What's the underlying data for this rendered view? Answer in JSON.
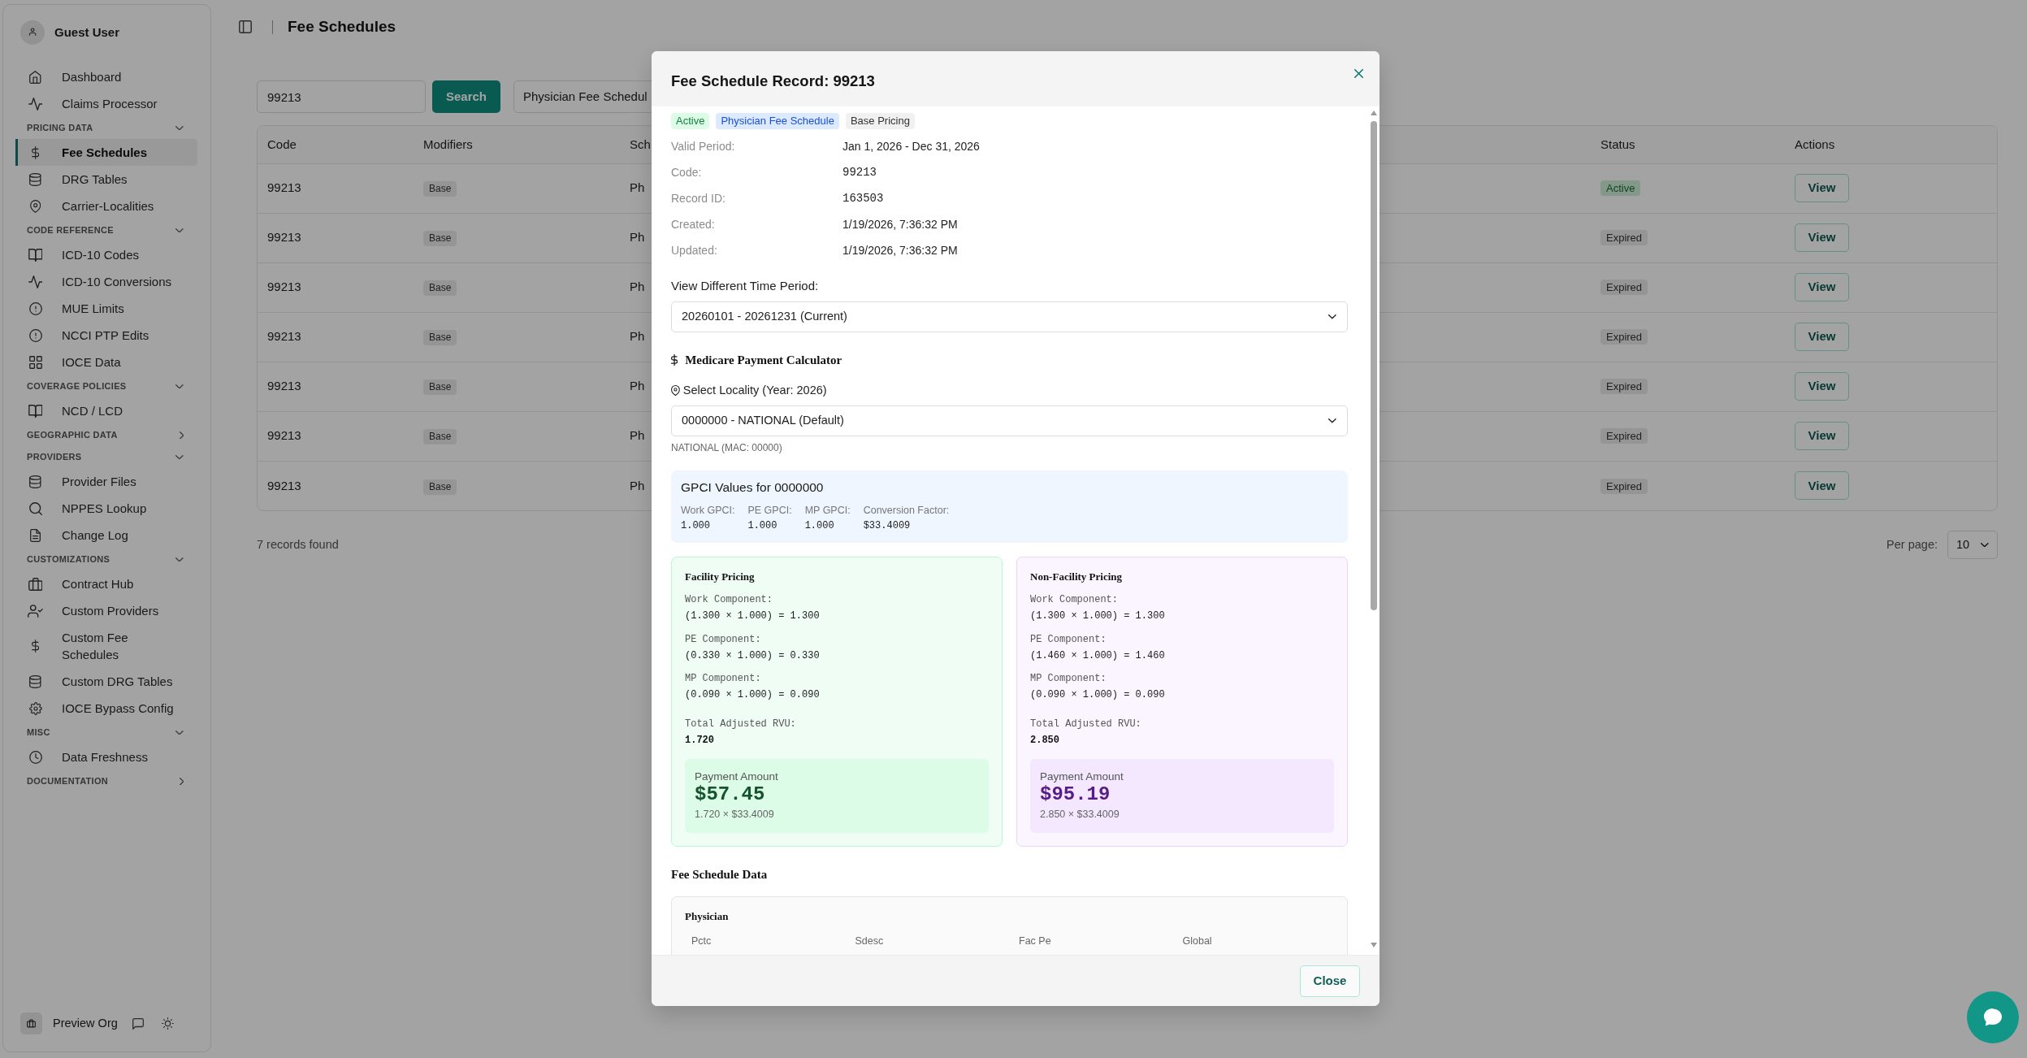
{
  "sidebar": {
    "user": "Guest User",
    "nav": [
      {
        "kind": "link",
        "label": "Dashboard",
        "selected": false
      },
      {
        "kind": "link",
        "label": "Claims Processor",
        "selected": false
      },
      {
        "kind": "section",
        "label": "PRICING DATA",
        "expanded": true,
        "children": [
          {
            "label": "Fee Schedules",
            "selected": true
          },
          {
            "label": "DRG Tables",
            "selected": false
          },
          {
            "label": "Carrier-Localities",
            "selected": false
          }
        ]
      },
      {
        "kind": "section",
        "label": "CODE REFERENCE",
        "expanded": true,
        "children": [
          {
            "label": "ICD-10 Codes",
            "selected": false
          },
          {
            "label": "ICD-10 Conversions",
            "selected": false
          },
          {
            "label": "MUE Limits",
            "selected": false
          },
          {
            "label": "NCCI PTP Edits",
            "selected": false
          },
          {
            "label": "IOCE Data",
            "selected": false
          }
        ]
      },
      {
        "kind": "section",
        "label": "COVERAGE POLICIES",
        "expanded": true,
        "children": [
          {
            "label": "NCD / LCD",
            "selected": false
          }
        ]
      },
      {
        "kind": "section",
        "label": "GEOGRAPHIC DATA",
        "expanded": false
      },
      {
        "kind": "section",
        "label": "PROVIDERS",
        "expanded": true,
        "children": [
          {
            "label": "Provider Files",
            "selected": false
          },
          {
            "label": "NPPES Lookup",
            "selected": false
          },
          {
            "label": "Change Log",
            "selected": false
          }
        ]
      },
      {
        "kind": "section",
        "label": "CUSTOMIZATIONS",
        "expanded": true,
        "children": [
          {
            "label": "Contract Hub",
            "selected": false
          },
          {
            "label": "Custom Providers",
            "selected": false
          },
          {
            "label": "Custom Fee Schedules",
            "selected": false
          },
          {
            "label": "Custom DRG Tables",
            "selected": false
          },
          {
            "label": "IOCE Bypass Config",
            "selected": false
          }
        ]
      },
      {
        "kind": "section",
        "label": "MISC",
        "expanded": true,
        "children": [
          {
            "label": "Data Freshness",
            "selected": false
          }
        ]
      },
      {
        "kind": "section",
        "label": "DOCUMENTATION",
        "expanded": false
      }
    ],
    "org": "Preview Org"
  },
  "header": {
    "title": "Fee Schedules"
  },
  "search": {
    "value": "99213",
    "button": "Search",
    "schedule": "Physician Fee Schedul"
  },
  "table": {
    "columns": [
      "Code",
      "Modifiers",
      "Sch",
      "Status",
      "Actions"
    ],
    "rows": [
      {
        "kind": "active",
        "code": "99213",
        "modifier": "Base",
        "column_3": "Ph",
        "status": "Active",
        "action": "View"
      },
      {
        "kind": "expired",
        "code": "99213",
        "modifier": "Base",
        "column_3": "Ph",
        "status": "Expired",
        "action": "View"
      },
      {
        "kind": "expired",
        "code": "99213",
        "modifier": "Base",
        "column_3": "Ph",
        "status": "Expired",
        "action": "View"
      },
      {
        "kind": "expired",
        "code": "99213",
        "modifier": "Base",
        "column_3": "Ph",
        "status": "Expired",
        "action": "View"
      },
      {
        "kind": "expired",
        "code": "99213",
        "modifier": "Base",
        "column_3": "Ph",
        "status": "Expired",
        "action": "View"
      },
      {
        "kind": "expired",
        "code": "99213",
        "modifier": "Base",
        "column_3": "Ph",
        "status": "Expired",
        "action": "View"
      },
      {
        "kind": "expired",
        "code": "99213",
        "modifier": "Base",
        "column_3": "Ph",
        "status": "Expired",
        "action": "View"
      }
    ]
  },
  "records_found": "7 records found",
  "per_page": {
    "label": "Per page:",
    "value": "10"
  },
  "modal": {
    "title": "Fee Schedule Record: 99213",
    "badges": [
      {
        "label": "Active",
        "kind": "success"
      },
      {
        "label": "Physician Fee Schedule",
        "kind": "info"
      },
      {
        "label": "Base Pricing",
        "kind": "neutral"
      }
    ],
    "details": [
      {
        "label": "Valid Period:",
        "value": "Jan 1, 2026 - Dec 31, 2026",
        "kind": "text"
      },
      {
        "label": "Code:",
        "value": "99213",
        "kind": "code"
      },
      {
        "label": "Record ID:",
        "value": "163503",
        "kind": "code"
      },
      {
        "label": "Created:",
        "value": "1/19/2026, 7:36:32 PM",
        "kind": "text"
      },
      {
        "label": "Updated:",
        "value": "1/19/2026, 7:36:32 PM",
        "kind": "text"
      }
    ],
    "period": {
      "label": "View Different Time Period:",
      "value": "20260101 - 20261231 (Current)"
    },
    "calculator": {
      "title": "Medicare Payment Calculator",
      "locality_label": "Select Locality (Year: 2026)",
      "locality": "0000000 - NATIONAL (Default)",
      "locality_note": "NATIONAL (MAC: 00000)",
      "gpci": {
        "title": "GPCI Values for 0000000",
        "values": [
          {
            "label": "Work GPCI:",
            "value": "1.000"
          },
          {
            "label": "PE GPCI:",
            "value": "1.000"
          },
          {
            "label": "MP GPCI:",
            "value": "1.000"
          },
          {
            "label": "Conversion Factor:",
            "value": "$33.4009"
          }
        ]
      },
      "pricing": [
        {
          "kind": "facility",
          "title": "Facility Pricing",
          "components": [
            {
              "label": "Work Component:",
              "formula": "(1.300 × 1.000) = 1.300"
            },
            {
              "label": "PE Component:",
              "formula": "(0.330 × 1.000) = 0.330"
            },
            {
              "label": "MP Component:",
              "formula": "(0.090 × 1.000) = 0.090"
            }
          ],
          "total_label": "Total Adjusted RVU:",
          "total": "1.720",
          "payment_label": "Payment Amount",
          "payment": "$57.45",
          "payment_formula": "1.720 × $33.4009"
        },
        {
          "kind": "non_facility",
          "title": "Non-Facility Pricing",
          "components": [
            {
              "label": "Work Component:",
              "formula": "(1.300 × 1.000) = 1.300"
            },
            {
              "label": "PE Component:",
              "formula": "(1.460 × 1.000) = 1.460"
            },
            {
              "label": "MP Component:",
              "formula": "(0.090 × 1.000) = 0.090"
            }
          ],
          "total_label": "Total Adjusted RVU:",
          "total": "2.850",
          "payment_label": "Payment Amount",
          "payment": "$95.19",
          "payment_formula": "2.850 × $33.4009"
        }
      ]
    },
    "data_section": {
      "title": "Fee Schedule Data",
      "groups": [
        {
          "title": "Physician",
          "fields": [
            "Pctc",
            "Sdesc",
            "Fac Pe",
            "Global"
          ]
        }
      ]
    },
    "close_button": "Close"
  }
}
